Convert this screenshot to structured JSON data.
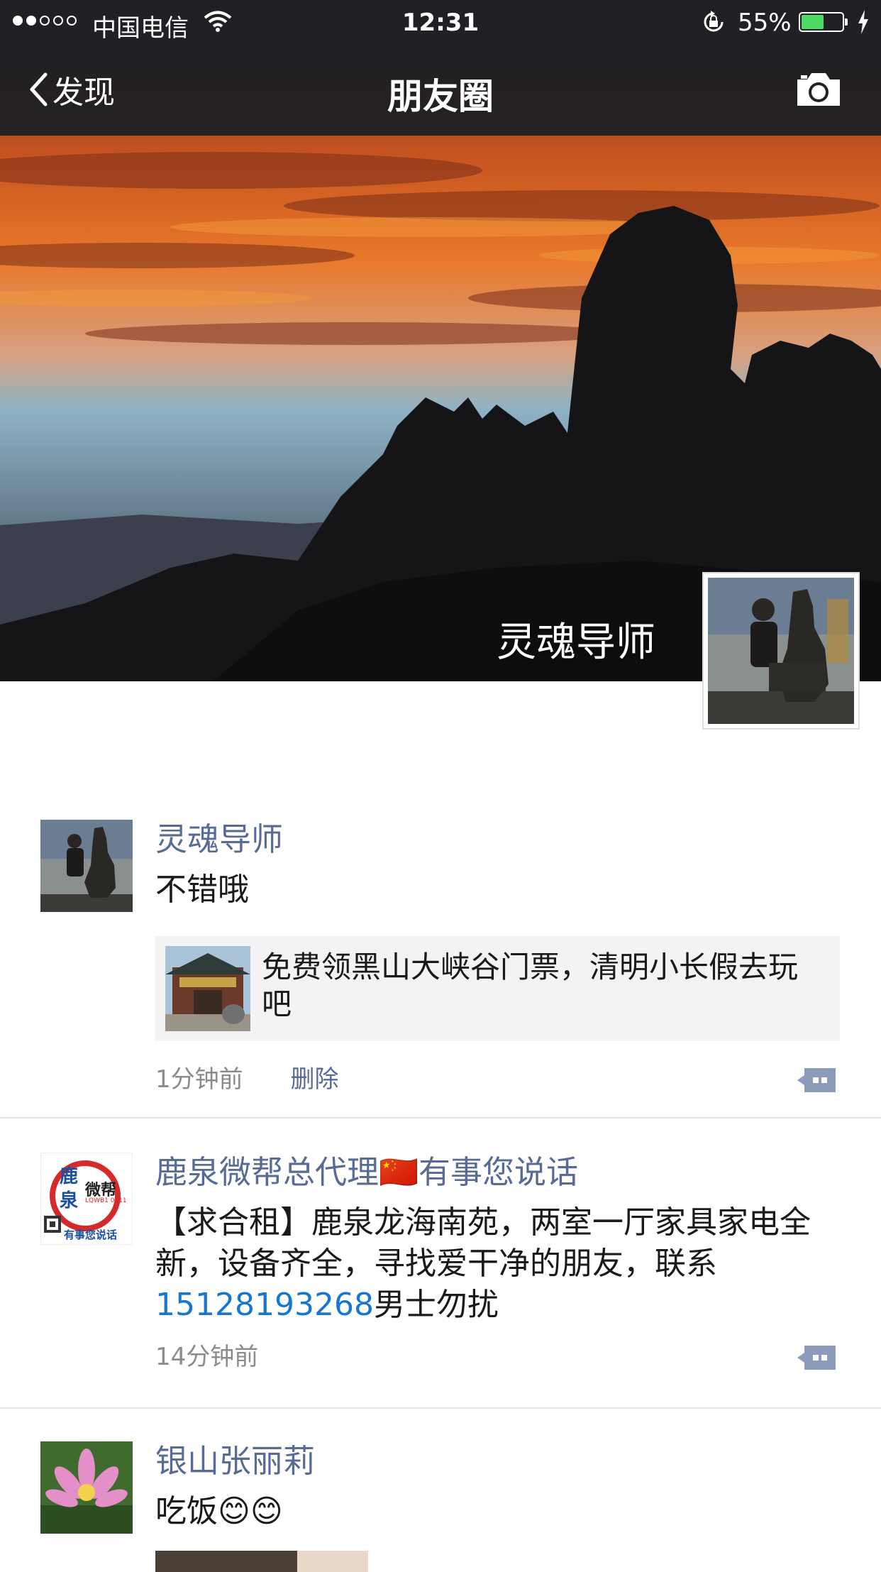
{
  "status_bar": {
    "carrier": "中国电信",
    "time": "12:31",
    "battery_percent_label": "55%",
    "battery_level": 0.55,
    "battery_color": "#4cd964"
  },
  "nav": {
    "back_label": "发现",
    "title": "朋友圈",
    "camera_icon": "camera-icon"
  },
  "cover": {
    "owner_name": "灵魂导师"
  },
  "posts": [
    {
      "author": "灵魂导师",
      "text": "不错哦",
      "link": {
        "title": "免费领黑山大峡谷门票，清明小长假去玩吧"
      },
      "time": "1分钟前",
      "delete_label": "删除"
    },
    {
      "author": "鹿泉微帮总代理🇨🇳有事您说话",
      "text_before": "【求合租】鹿泉龙海南苑，两室一厅家具家电全新，设备齐全，寻找爱干净的朋友，联系",
      "phone": "15128193268",
      "text_after": "男士勿扰",
      "time": "14分钟前",
      "avatar_text": {
        "line1": "鹿",
        "line2": "泉",
        "brand": "微帮",
        "code": "LQWB1 0311",
        "slogan": "有事您说话"
      }
    },
    {
      "author": "银山张丽莉",
      "text": "吃饭😊😊"
    }
  ],
  "colors": {
    "name_link": "#576b95",
    "phone_link": "#1677d2",
    "bar_bg": "#1f1f24"
  }
}
